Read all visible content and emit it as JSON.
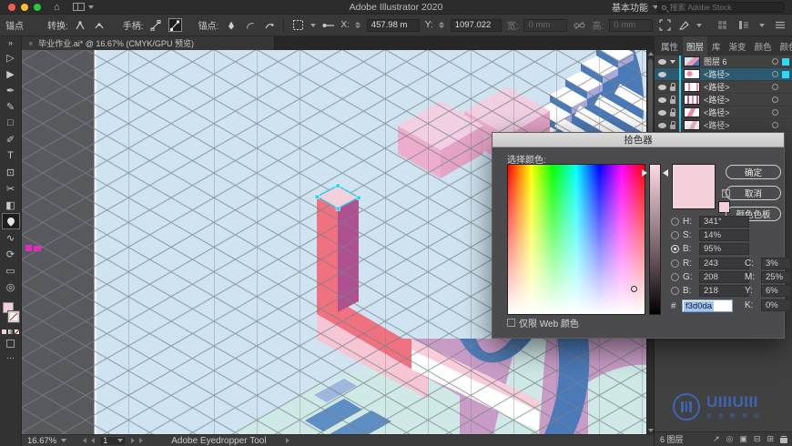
{
  "titlebar": {
    "title": "Adobe Illustrator 2020",
    "workspace_switcher": "基本功能",
    "search_placeholder": "搜索 Adobe Stock"
  },
  "controlbar": {
    "anchor_label": "锚点",
    "convert_label": "转换:",
    "handles_label": "手柄:",
    "anchor_point_label": "锚点:",
    "x_label": "X:",
    "x_value": "457.98 m",
    "y_label": "Y:",
    "y_value": "1097.022",
    "width_label": "宽:",
    "width_value": "0 mm",
    "height_label": "高:",
    "height_value": "0 mm"
  },
  "tabbar": {
    "close_glyph": "×",
    "title": "毕业作业.ai* @ 16.67% (CMYK/GPU 预览)"
  },
  "toolbar": {
    "tools": [
      {
        "name": "toolbar-collapse",
        "glyph": "»"
      },
      {
        "name": "selection-tool",
        "glyph": "▷"
      },
      {
        "name": "direct-selection-tool",
        "glyph": "▶"
      },
      {
        "name": "pen-tool",
        "glyph": "✒"
      },
      {
        "name": "curvature-tool",
        "glyph": "✎"
      },
      {
        "name": "rectangle-tool",
        "glyph": "□"
      },
      {
        "name": "paintbrush-tool",
        "glyph": "✐"
      },
      {
        "name": "type-tool",
        "glyph": "T"
      },
      {
        "name": "free-transform-tool",
        "glyph": "⊡"
      },
      {
        "name": "scissors-tool",
        "glyph": "✂"
      },
      {
        "name": "gradient-tool",
        "glyph": "◧"
      },
      {
        "name": "eyedropper-tool",
        "glyph": "",
        "selected": true
      },
      {
        "name": "blend-tool",
        "glyph": "∿"
      },
      {
        "name": "rotate-tool",
        "glyph": "⟳"
      },
      {
        "name": "artboard-tool",
        "glyph": "▭"
      },
      {
        "name": "zoom-tool",
        "glyph": "◎"
      },
      {
        "name": "more-tools",
        "glyph": "⋯"
      }
    ]
  },
  "color_picker": {
    "title": "拾色器",
    "select_color_label": "选择颜色:",
    "ok": "确定",
    "cancel": "取消",
    "color_swatches": "颜色色板",
    "rows": {
      "h": {
        "label": "H:",
        "value": "341°"
      },
      "s": {
        "label": "S:",
        "value": "14%"
      },
      "b": {
        "label": "B:",
        "value": "95%"
      },
      "r": {
        "label": "R:",
        "value": "243"
      },
      "g": {
        "label": "G:",
        "value": "208"
      },
      "b2": {
        "label": "B:",
        "value": "218"
      },
      "c": {
        "label": "C:",
        "value": "3%"
      },
      "m": {
        "label": "M:",
        "value": "25%"
      },
      "y": {
        "label": "Y:",
        "value": "6%"
      },
      "k": {
        "label": "K:",
        "value": "0%"
      }
    },
    "hex_label": "#",
    "hex_value": "f3d0da",
    "web_only_label": "仅限 Web 颜色",
    "current_color": "#f3d0da"
  },
  "layers_panel": {
    "tabs": [
      "属性",
      "图层",
      "库",
      "渐变",
      "颜色",
      "颜色参"
    ],
    "menu_glyph": "≡",
    "rows": [
      {
        "label": "图层 6"
      },
      {
        "label": "<路径>"
      },
      {
        "label": "<路径>"
      },
      {
        "label": "<路径>"
      },
      {
        "label": "<路径>"
      },
      {
        "label": "<路径>"
      }
    ],
    "footer_count": "6 图层",
    "footer_icons": [
      {
        "name": "collect-for-export-icon",
        "glyph": "↗"
      },
      {
        "name": "locate-object-icon",
        "glyph": "◎"
      },
      {
        "name": "make-clipping-mask-icon",
        "glyph": "▣"
      },
      {
        "name": "new-sublayer-icon",
        "glyph": "⊟"
      },
      {
        "name": "new-layer-icon",
        "glyph": "⊞"
      }
    ]
  },
  "statusbar": {
    "zoom": "16.67%",
    "artboard_number": "1",
    "tool_name": "Adobe Eyedropper Tool"
  },
  "watermark": {
    "text": "UIIIUIII",
    "subtext": "优 优 教 程 网"
  },
  "colors": {
    "accent_cyan": "#2ed9f2",
    "artboard": "#cfe3f0",
    "pasteboard": "#58595c",
    "salmon": "#f0717f",
    "selected_top_pink": "#f3d0da",
    "mauve_dark": "#ae5190",
    "mauve": "#c89cc6",
    "mint": "#cfe9e6",
    "blue": "#4a7ab8",
    "lavender": "#a9aad8",
    "pale_pink": "#f6c3d2"
  }
}
